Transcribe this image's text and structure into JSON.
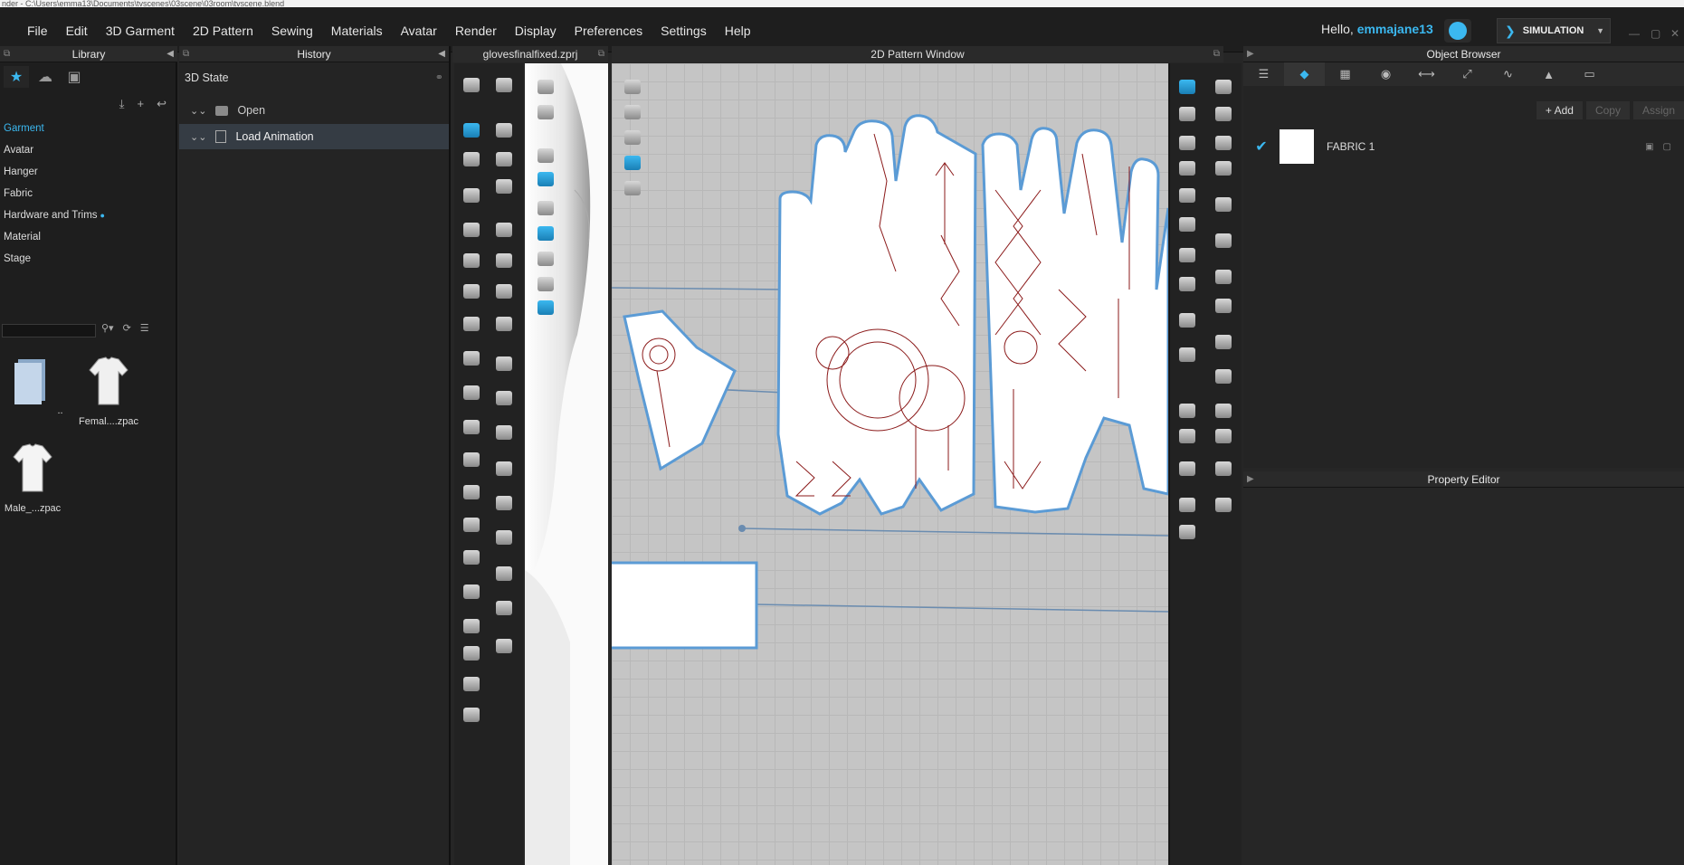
{
  "titlebar": {
    "path": "nder - C:\\Users\\emma13\\Documents\\tvscenes\\03scene\\03room\\tvscene.blend"
  },
  "menu": {
    "items": [
      "File",
      "Edit",
      "3D Garment",
      "2D Pattern",
      "Sewing",
      "Materials",
      "Avatar",
      "Render",
      "Display",
      "Preferences",
      "Settings",
      "Help"
    ],
    "greeting": "Hello,",
    "username": "emmajane13",
    "simulation": "SIMULATION"
  },
  "library": {
    "title": "Library",
    "categories": [
      "Garment",
      "Avatar",
      "Hanger",
      "Fabric",
      "Hardware and Trims",
      "Material",
      "Stage"
    ],
    "items": [
      "..",
      "Femal....zpac",
      "Male_...zpac"
    ]
  },
  "history": {
    "title": "History",
    "state_title": "3D State",
    "rows": [
      "Open",
      "Load Animation"
    ]
  },
  "view3d": {
    "title": "glovesfinalfixed.zprj"
  },
  "pattern2d": {
    "title": "2D Pattern Window"
  },
  "object_browser": {
    "title": "Object Browser",
    "buttons": [
      "Add",
      "Copy",
      "Assign"
    ],
    "fabrics": [
      "FABRIC 1"
    ]
  },
  "property_editor": {
    "title": "Property Editor"
  },
  "colors": {
    "accent": "#3bb8f0",
    "pattern_outline": "#5b9bd5",
    "pattern_stitch": "#8b1a1a"
  }
}
